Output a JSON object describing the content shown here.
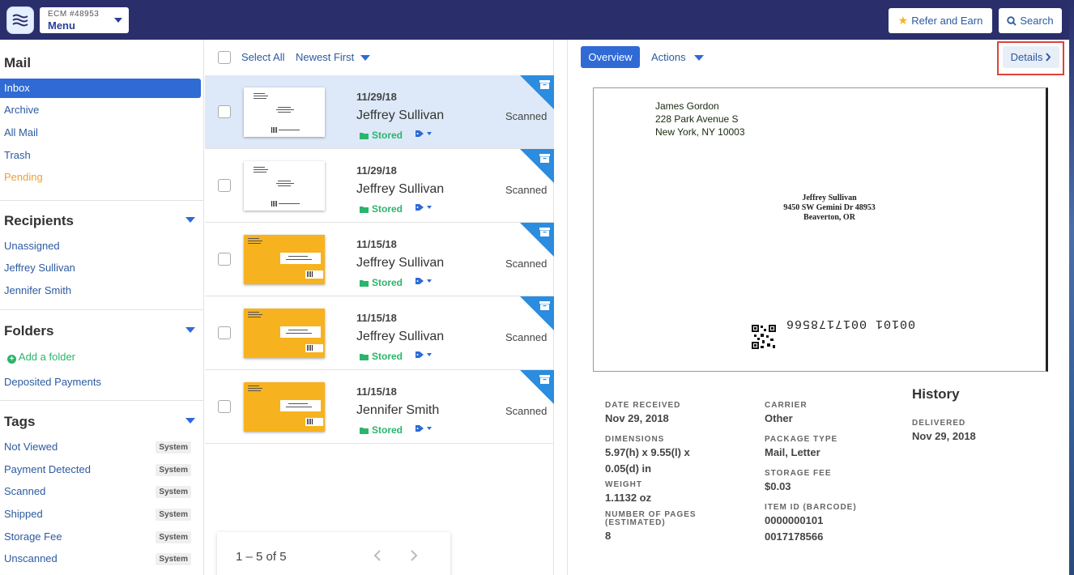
{
  "topbar": {
    "account_id": "ECM #48953",
    "menu_label": "Menu",
    "refer_label": "Refer and Earn",
    "search_label": "Search"
  },
  "sidebar": {
    "mail_title": "Mail",
    "mail_items": [
      "Inbox",
      "Archive",
      "All Mail",
      "Trash",
      "Pending"
    ],
    "recipients_title": "Recipients",
    "recipients": [
      "Unassigned",
      "Jeffrey Sullivan",
      "Jennifer Smith"
    ],
    "folders_title": "Folders",
    "add_folder": "Add a folder",
    "folders": [
      "Deposited Payments"
    ],
    "tags_title": "Tags",
    "tags": [
      {
        "label": "Not Viewed",
        "badge": "System"
      },
      {
        "label": "Payment Detected",
        "badge": "System"
      },
      {
        "label": "Scanned",
        "badge": "System"
      },
      {
        "label": "Shipped",
        "badge": "System"
      },
      {
        "label": "Storage Fee",
        "badge": "System"
      },
      {
        "label": "Unscanned",
        "badge": "System"
      }
    ]
  },
  "list": {
    "select_all": "Select All",
    "sort": "Newest First",
    "rows": [
      {
        "date": "11/29/18",
        "name": "Jeffrey Sullivan",
        "stored": "Stored",
        "status": "Scanned",
        "thumb": "white"
      },
      {
        "date": "11/29/18",
        "name": "Jeffrey Sullivan",
        "stored": "Stored",
        "status": "Scanned",
        "thumb": "white"
      },
      {
        "date": "11/15/18",
        "name": "Jeffrey Sullivan",
        "stored": "Stored",
        "status": "Scanned",
        "thumb": "yellow"
      },
      {
        "date": "11/15/18",
        "name": "Jeffrey Sullivan",
        "stored": "Stored",
        "status": "Scanned",
        "thumb": "yellow"
      },
      {
        "date": "11/15/18",
        "name": "Jennifer Smith",
        "stored": "Stored",
        "status": "Scanned",
        "thumb": "yellow"
      }
    ],
    "pagination": "1 – 5 of 5"
  },
  "detail": {
    "overview_label": "Overview",
    "actions_label": "Actions",
    "details_label": "Details",
    "envelope": {
      "return_lines": [
        "James Gordon",
        "228 Park Avenue S",
        "New York, NY 10003"
      ],
      "to_lines": [
        "Jeffrey Sullivan",
        "9450 SW Gemini Dr 48953",
        "Beaverton, OR"
      ],
      "barcode": "00101 0017178566"
    },
    "fields": {
      "date_received_label": "DATE RECEIVED",
      "date_received": "Nov 29, 2018",
      "dimensions_label": "DIMENSIONS",
      "dimensions_1": "5.97(h) x 9.55(l) x",
      "dimensions_2": "0.05(d) in",
      "weight_label": "WEIGHT",
      "weight": "1.1132 oz",
      "pages_label_1": "NUMBER OF PAGES",
      "pages_label_2": "(ESTIMATED)",
      "pages": "8",
      "carrier_label": "CARRIER",
      "carrier": "Other",
      "package_label": "PACKAGE TYPE",
      "package": "Mail, Letter",
      "storage_label": "STORAGE FEE",
      "storage": "$0.03",
      "itemid_label": "ITEM ID (BARCODE)",
      "itemid_1": "0000000101",
      "itemid_2": "0017178566"
    },
    "history_title": "History",
    "delivered_label": "DELIVERED",
    "delivered": "Nov 29, 2018"
  },
  "colors": {
    "topbar": "#2a2f6b",
    "accent": "#2f6ad5",
    "stored": "#2bb56a",
    "pending": "#f0a030",
    "highlight": "#e0423a"
  }
}
